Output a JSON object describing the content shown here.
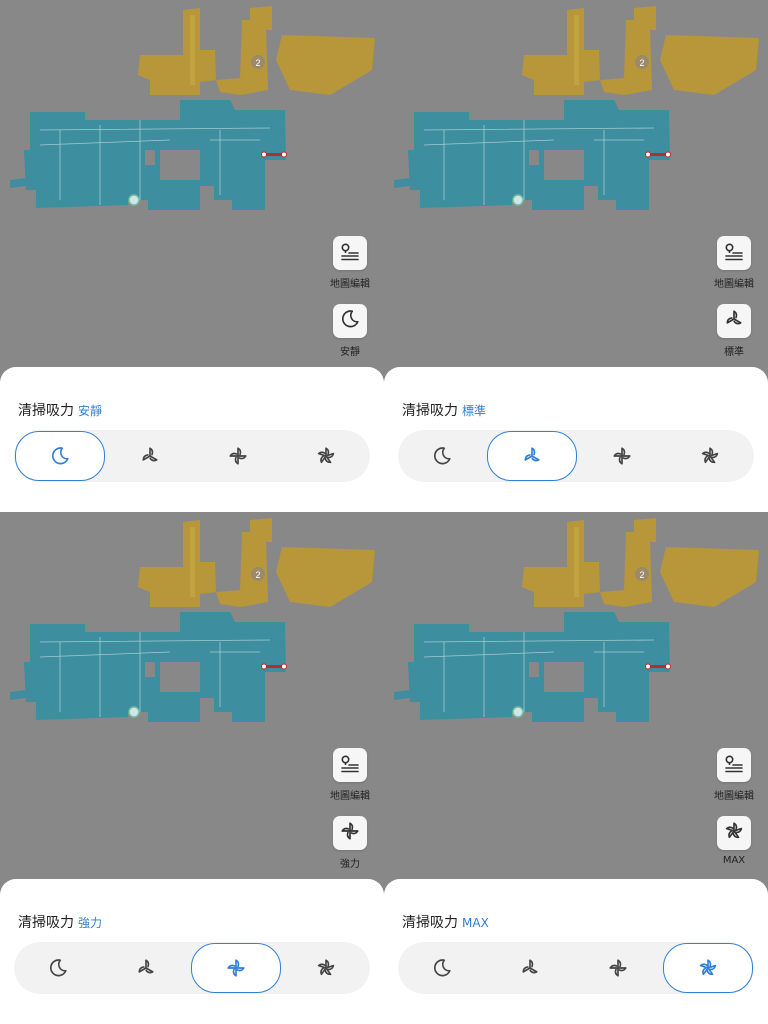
{
  "panels": [
    {
      "map_edit_label": "地圖編輯",
      "mode_label": "安靜",
      "sheet_title": "清掃吸力",
      "current_mode": "安靜",
      "selected_index": 0
    },
    {
      "map_edit_label": "地圖編輯",
      "mode_label": "標準",
      "sheet_title": "清掃吸力",
      "current_mode": "標準",
      "selected_index": 1
    },
    {
      "map_edit_label": "地圖編輯",
      "mode_label": "強力",
      "sheet_title": "清掃吸力",
      "current_mode": "強力",
      "selected_index": 2
    },
    {
      "map_edit_label": "地圖編輯",
      "mode_label": "MAX",
      "sheet_title": "清掃吸力",
      "current_mode": "MAX",
      "selected_index": 3
    }
  ],
  "suction_modes": [
    "moon-icon",
    "fan-standard-icon",
    "fan-strong-icon",
    "fan-max-icon"
  ],
  "colors": {
    "accent": "#2f7fd6",
    "map_room_gold": "#b89a3a",
    "map_room_teal": "#3f8fa0",
    "backdrop": "#888888"
  },
  "room_badge": "2"
}
